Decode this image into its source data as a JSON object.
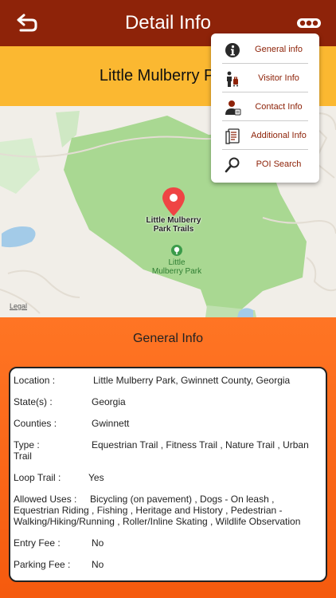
{
  "header": {
    "title": "Detail Info",
    "back_icon": "back-arrow-icon",
    "more_icon": "more-dots-icon"
  },
  "park_name": "Little Mulberry Park",
  "map": {
    "trail_label_line1": "Little Mulberry",
    "trail_label_line2": "Park Trails",
    "park_label_line1": "Little",
    "park_label_line2": "Mulberry Park",
    "legal": "Legal"
  },
  "section_title": "General Info",
  "info": [
    {
      "label": "Location  :",
      "value": "Little Mulberry Park, Gwinnett County, Georgia"
    },
    {
      "label": "State(s)  :",
      "value": "Georgia"
    },
    {
      "label": "Counties  :",
      "value": "Gwinnett"
    },
    {
      "label": "Type   :",
      "value": "Equestrian Trail , Fitness Trail , Nature Trail , Urban",
      "value_cont": "Trail"
    },
    {
      "label": "Loop Trail  :",
      "value": "Yes"
    },
    {
      "label": "Allowed Uses  :",
      "value": "Bicycling (on pavement) , Dogs - On leash ,",
      "value_cont": "Equestrian  Riding , Fishing , Heritage and History , Pedestrian -",
      "value_cont2": "Walking/Hiking/Running , Roller/Inline Skating , Wildlife Observation"
    },
    {
      "label": "Entry Fee  :",
      "value": "No"
    },
    {
      "label": "Parking Fee  :",
      "value": "No"
    }
  ],
  "menu": [
    {
      "label": "General info",
      "icon": "info-icon"
    },
    {
      "label": "Visitor Info",
      "icon": "visitor-icon"
    },
    {
      "label": "Contact Info",
      "icon": "contact-icon"
    },
    {
      "label": "Additional Info",
      "icon": "document-icon"
    },
    {
      "label": "POI Search",
      "icon": "search-icon"
    }
  ],
  "colors": {
    "header": "#8e2309",
    "band": "#fbb831",
    "content": "#f55a0e",
    "menu_text": "#8e2309"
  }
}
